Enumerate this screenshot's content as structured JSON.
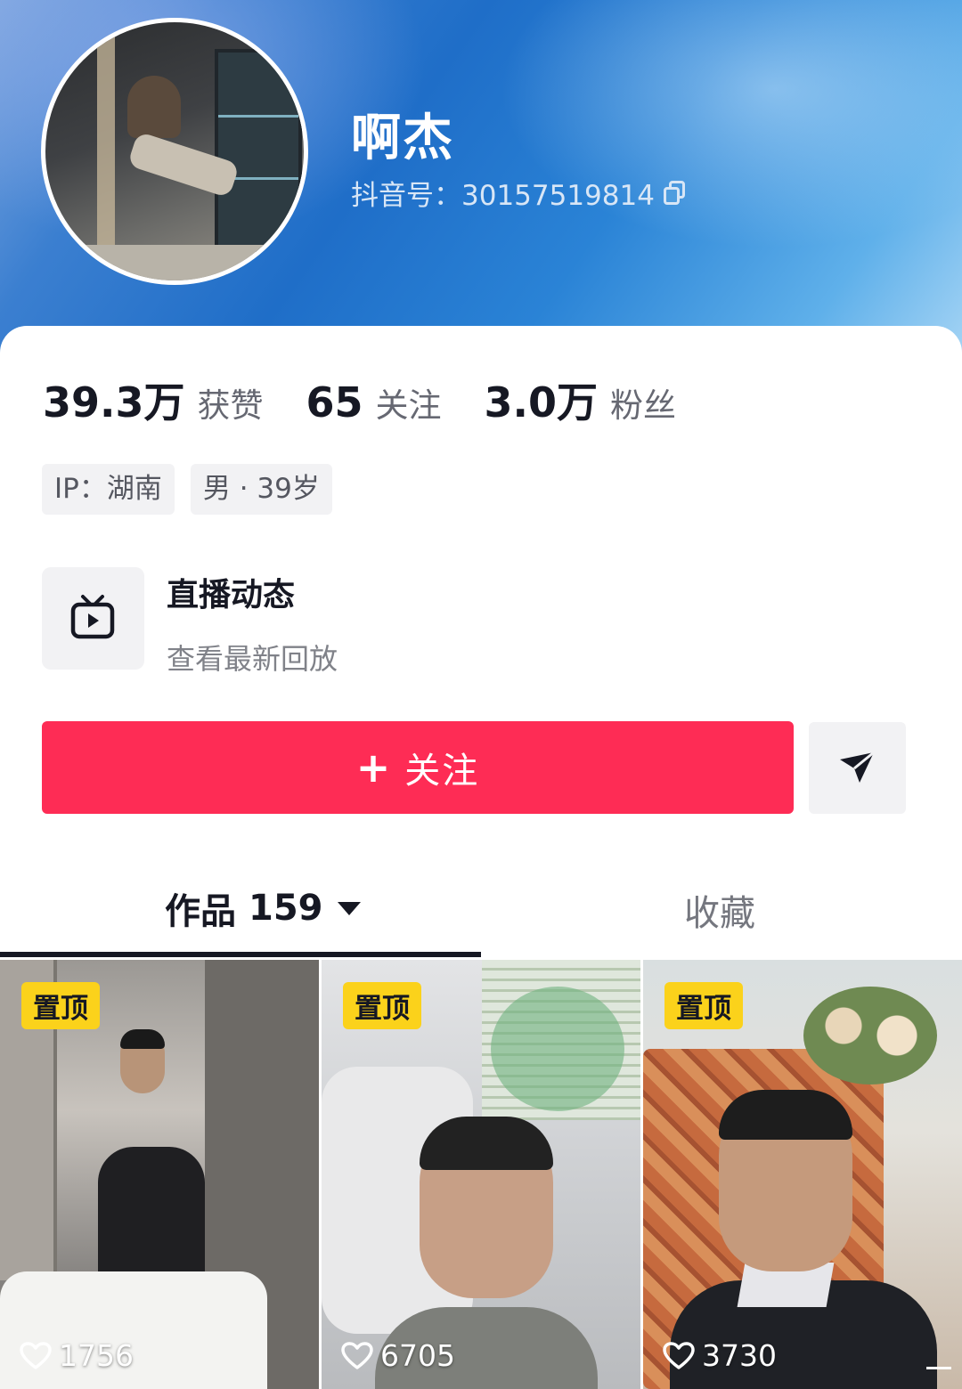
{
  "profile": {
    "name": "啊杰",
    "douyin_id": "抖音号：30157519814"
  },
  "stats": [
    {
      "value": "39.3万",
      "label": "获赞"
    },
    {
      "value": "65",
      "label": "关注"
    },
    {
      "value": "3.0万",
      "label": "粉丝"
    }
  ],
  "tags": [
    "IP：湖南",
    "男 · 39岁"
  ],
  "live": {
    "title": "直播动态",
    "subtitle": "查看最新回放"
  },
  "actions": {
    "follow_label": "关注",
    "follow_plus": "+"
  },
  "tabs": {
    "works_label": "作品",
    "works_count": "159",
    "favorites_label": "收藏"
  },
  "videos": [
    {
      "badge": "置顶",
      "likes": "1756"
    },
    {
      "badge": "置顶",
      "likes": "6705"
    },
    {
      "badge": "置顶",
      "likes": "3730"
    }
  ],
  "colors": {
    "follow_button": "#fe2c55",
    "pin_badge": "#fbd21b",
    "header_gradient_mid": "#1f6ec8"
  },
  "icons": [
    "copy-icon",
    "tv-play-icon",
    "share-arrow-icon",
    "caret-down-icon",
    "heart-icon"
  ]
}
